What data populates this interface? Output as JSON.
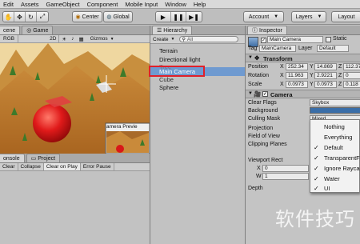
{
  "menu": [
    "Edit",
    "Assets",
    "GameObject",
    "Component",
    "Mobile Input",
    "Window",
    "Help"
  ],
  "toolbar": {
    "pivot_label": "Center",
    "space_label": "Global",
    "account_label": "Account",
    "layers_label": "Layers",
    "layout_label": "Layout"
  },
  "scene": {
    "tabs": [
      "cene",
      "Game"
    ],
    "shading": "RGB",
    "mode_2d": "2D",
    "gizmos_label": "Gizmos",
    "camera_preview_label": "amera Previe"
  },
  "console": {
    "tabs": [
      "onsole",
      "Project"
    ],
    "buttons": [
      "Clear",
      "Collapse",
      "Clear on Play",
      "Error Pause"
    ]
  },
  "hierarchy": {
    "tab_label": "Hierarchy",
    "create_label": "Create",
    "search_label": "All",
    "items": [
      "Terrain",
      "Directional light",
      "Tree",
      "Main Camera",
      "Cube",
      "Sphere"
    ],
    "selected": "Main Camera"
  },
  "inspector": {
    "tab_label": "Inspector",
    "object_name": "Main Camera",
    "static_label": "Static",
    "tag_label": "Tag",
    "tag_value": "MainCamera",
    "layer_label": "Layer",
    "layer_value": "Default",
    "transform": {
      "title": "Transform",
      "position_label": "Position",
      "rotation_label": "Rotation",
      "scale_label": "Scale",
      "position": [
        "252.34",
        "14.869",
        "112.37"
      ],
      "rotation": [
        "11.963",
        "2.9221",
        "0"
      ],
      "scale": [
        "0.0973",
        "0.0973",
        "0.118"
      ]
    },
    "camera": {
      "title": "Camera",
      "clear_flags_label": "Clear Flags",
      "clear_flags_value": "Skybox",
      "background_label": "Background",
      "background_color": "#3a6ea8",
      "culling_mask_label": "Culling Mask",
      "culling_mask_value": "Mixed ...",
      "projection_label": "Projection",
      "fov_label": "Field of View",
      "clipping_label": "Clipping Planes",
      "viewport_label": "Viewport Rect",
      "viewport_x_label": "X",
      "viewport_x_value": "0",
      "viewport_w_label": "W",
      "viewport_w_value": "1",
      "depth_label": "Depth"
    }
  },
  "culling_dropdown": {
    "options": [
      {
        "label": "Nothing",
        "checked": false
      },
      {
        "label": "Everything",
        "checked": false
      },
      {
        "label": "Default",
        "checked": true
      },
      {
        "label": "TransparentFX",
        "checked": true
      },
      {
        "label": "Ignore Raycast",
        "checked": true
      },
      {
        "label": "Water",
        "checked": true
      },
      {
        "label": "UI",
        "checked": true
      }
    ]
  },
  "watermark": "软件技巧",
  "colors": {
    "highlight_box": "#e0202a",
    "selection": "#6f9ad0",
    "sphere": "#e02020"
  }
}
